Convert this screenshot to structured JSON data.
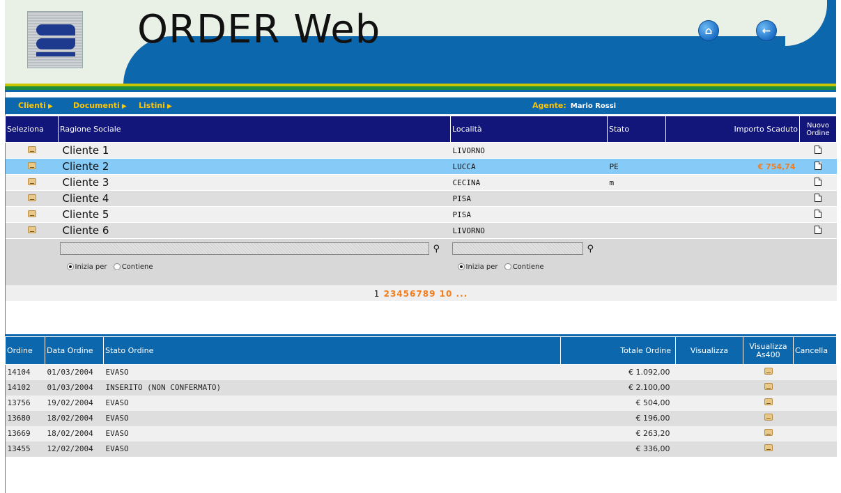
{
  "app": {
    "title": "ORDER Web"
  },
  "nav": {
    "items": [
      {
        "label": "Clienti"
      },
      {
        "label": "Documenti"
      },
      {
        "label": "Listini"
      }
    ],
    "agent_label": "Agente:",
    "agent_name": "Mario Rossi"
  },
  "clients": {
    "headers": {
      "select": "Seleziona",
      "name": "Ragione Sociale",
      "location": "Località",
      "state": "Stato",
      "overdue": "Importo Scaduto",
      "new_order_line1": "Nuovo",
      "new_order_line2": "Ordine"
    },
    "rows": [
      {
        "name": "Cliente 1",
        "location": "LIVORNO",
        "state": "",
        "overdue": ""
      },
      {
        "name": "Cliente 2",
        "location": "LUCCA",
        "state": "PE",
        "overdue": "€ 754,74"
      },
      {
        "name": "Cliente 3",
        "location": "CECINA",
        "state": "m",
        "overdue": ""
      },
      {
        "name": "Cliente 4",
        "location": "PISA",
        "state": "",
        "overdue": ""
      },
      {
        "name": "Cliente 5",
        "location": "PISA",
        "state": "",
        "overdue": ""
      },
      {
        "name": "Cliente 6",
        "location": "LIVORNO",
        "state": "",
        "overdue": ""
      }
    ],
    "filter": {
      "starts_with": "Inizia per",
      "contains": "Contiene"
    },
    "pager": {
      "current": "1",
      "pages": [
        "2",
        "3",
        "4",
        "5",
        "6",
        "7",
        "8",
        "9",
        "10",
        "..."
      ]
    }
  },
  "orders": {
    "headers": {
      "order": "Ordine",
      "date": "Data Ordine",
      "status": "Stato Ordine",
      "total": "Totale Ordine",
      "view": "Visualizza",
      "view_as400_line1": "Visualizza",
      "view_as400_line2": "As400",
      "delete": "Cancella"
    },
    "rows": [
      {
        "id": "14104",
        "date": "01/03/2004",
        "status": "EVASO",
        "total": "€ 1.092,00"
      },
      {
        "id": "14102",
        "date": "01/03/2004",
        "status": "INSERITO (NON CONFERMATO)",
        "total": "€ 2.100,00"
      },
      {
        "id": "13756",
        "date": "19/02/2004",
        "status": "EVASO",
        "total": "€ 504,00"
      },
      {
        "id": "13680",
        "date": "18/02/2004",
        "status": "EVASO",
        "total": "€ 196,00"
      },
      {
        "id": "13669",
        "date": "18/02/2004",
        "status": "EVASO",
        "total": "€ 263,20"
      },
      {
        "id": "13455",
        "date": "12/02/2004",
        "status": "EVASO",
        "total": "€ 336,00"
      }
    ]
  },
  "icons": {
    "home": "home-icon",
    "back": "back-arrow-icon",
    "select": "select-folder-icon",
    "new_order": "new-document-icon",
    "search": "binoculars-icon"
  },
  "colors": {
    "header_blue": "#0d67ad",
    "table_header_navy": "#12157a",
    "nav_yellow": "#ffc400",
    "highlight_row": "#86cbf7",
    "amount_orange": "#f07d1e"
  }
}
